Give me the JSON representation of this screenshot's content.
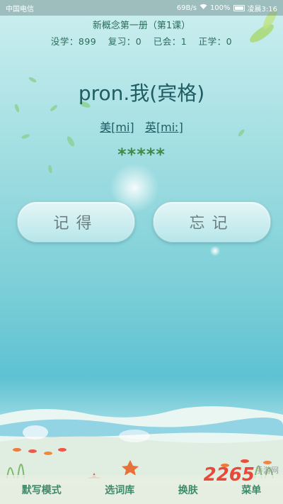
{
  "status_bar": {
    "carrier": "中国电信",
    "speed": "69B/s",
    "battery": "100%",
    "time": "凌晨3:16"
  },
  "header": {
    "title": "新概念第一册（第1课）"
  },
  "stats": {
    "not_learned": "没学：899",
    "review": "复习：0",
    "known": "已会：1",
    "learning": "正学：0"
  },
  "word_card": {
    "word": "pron.我(宾格)",
    "us_phonetic": "美[mi]",
    "uk_phonetic": "英[miː]",
    "stars": "*****"
  },
  "buttons": {
    "remember": "记得",
    "forget": "忘记"
  },
  "bottom_nav": {
    "items": [
      "默写模式",
      "选词库",
      "换肤",
      "菜单"
    ]
  },
  "watermark": {
    "brand": "2265",
    "suffix": "手游网"
  },
  "icons": [
    "wifi-icon",
    "battery-icon",
    "leaf-icon",
    "fish-icon"
  ]
}
